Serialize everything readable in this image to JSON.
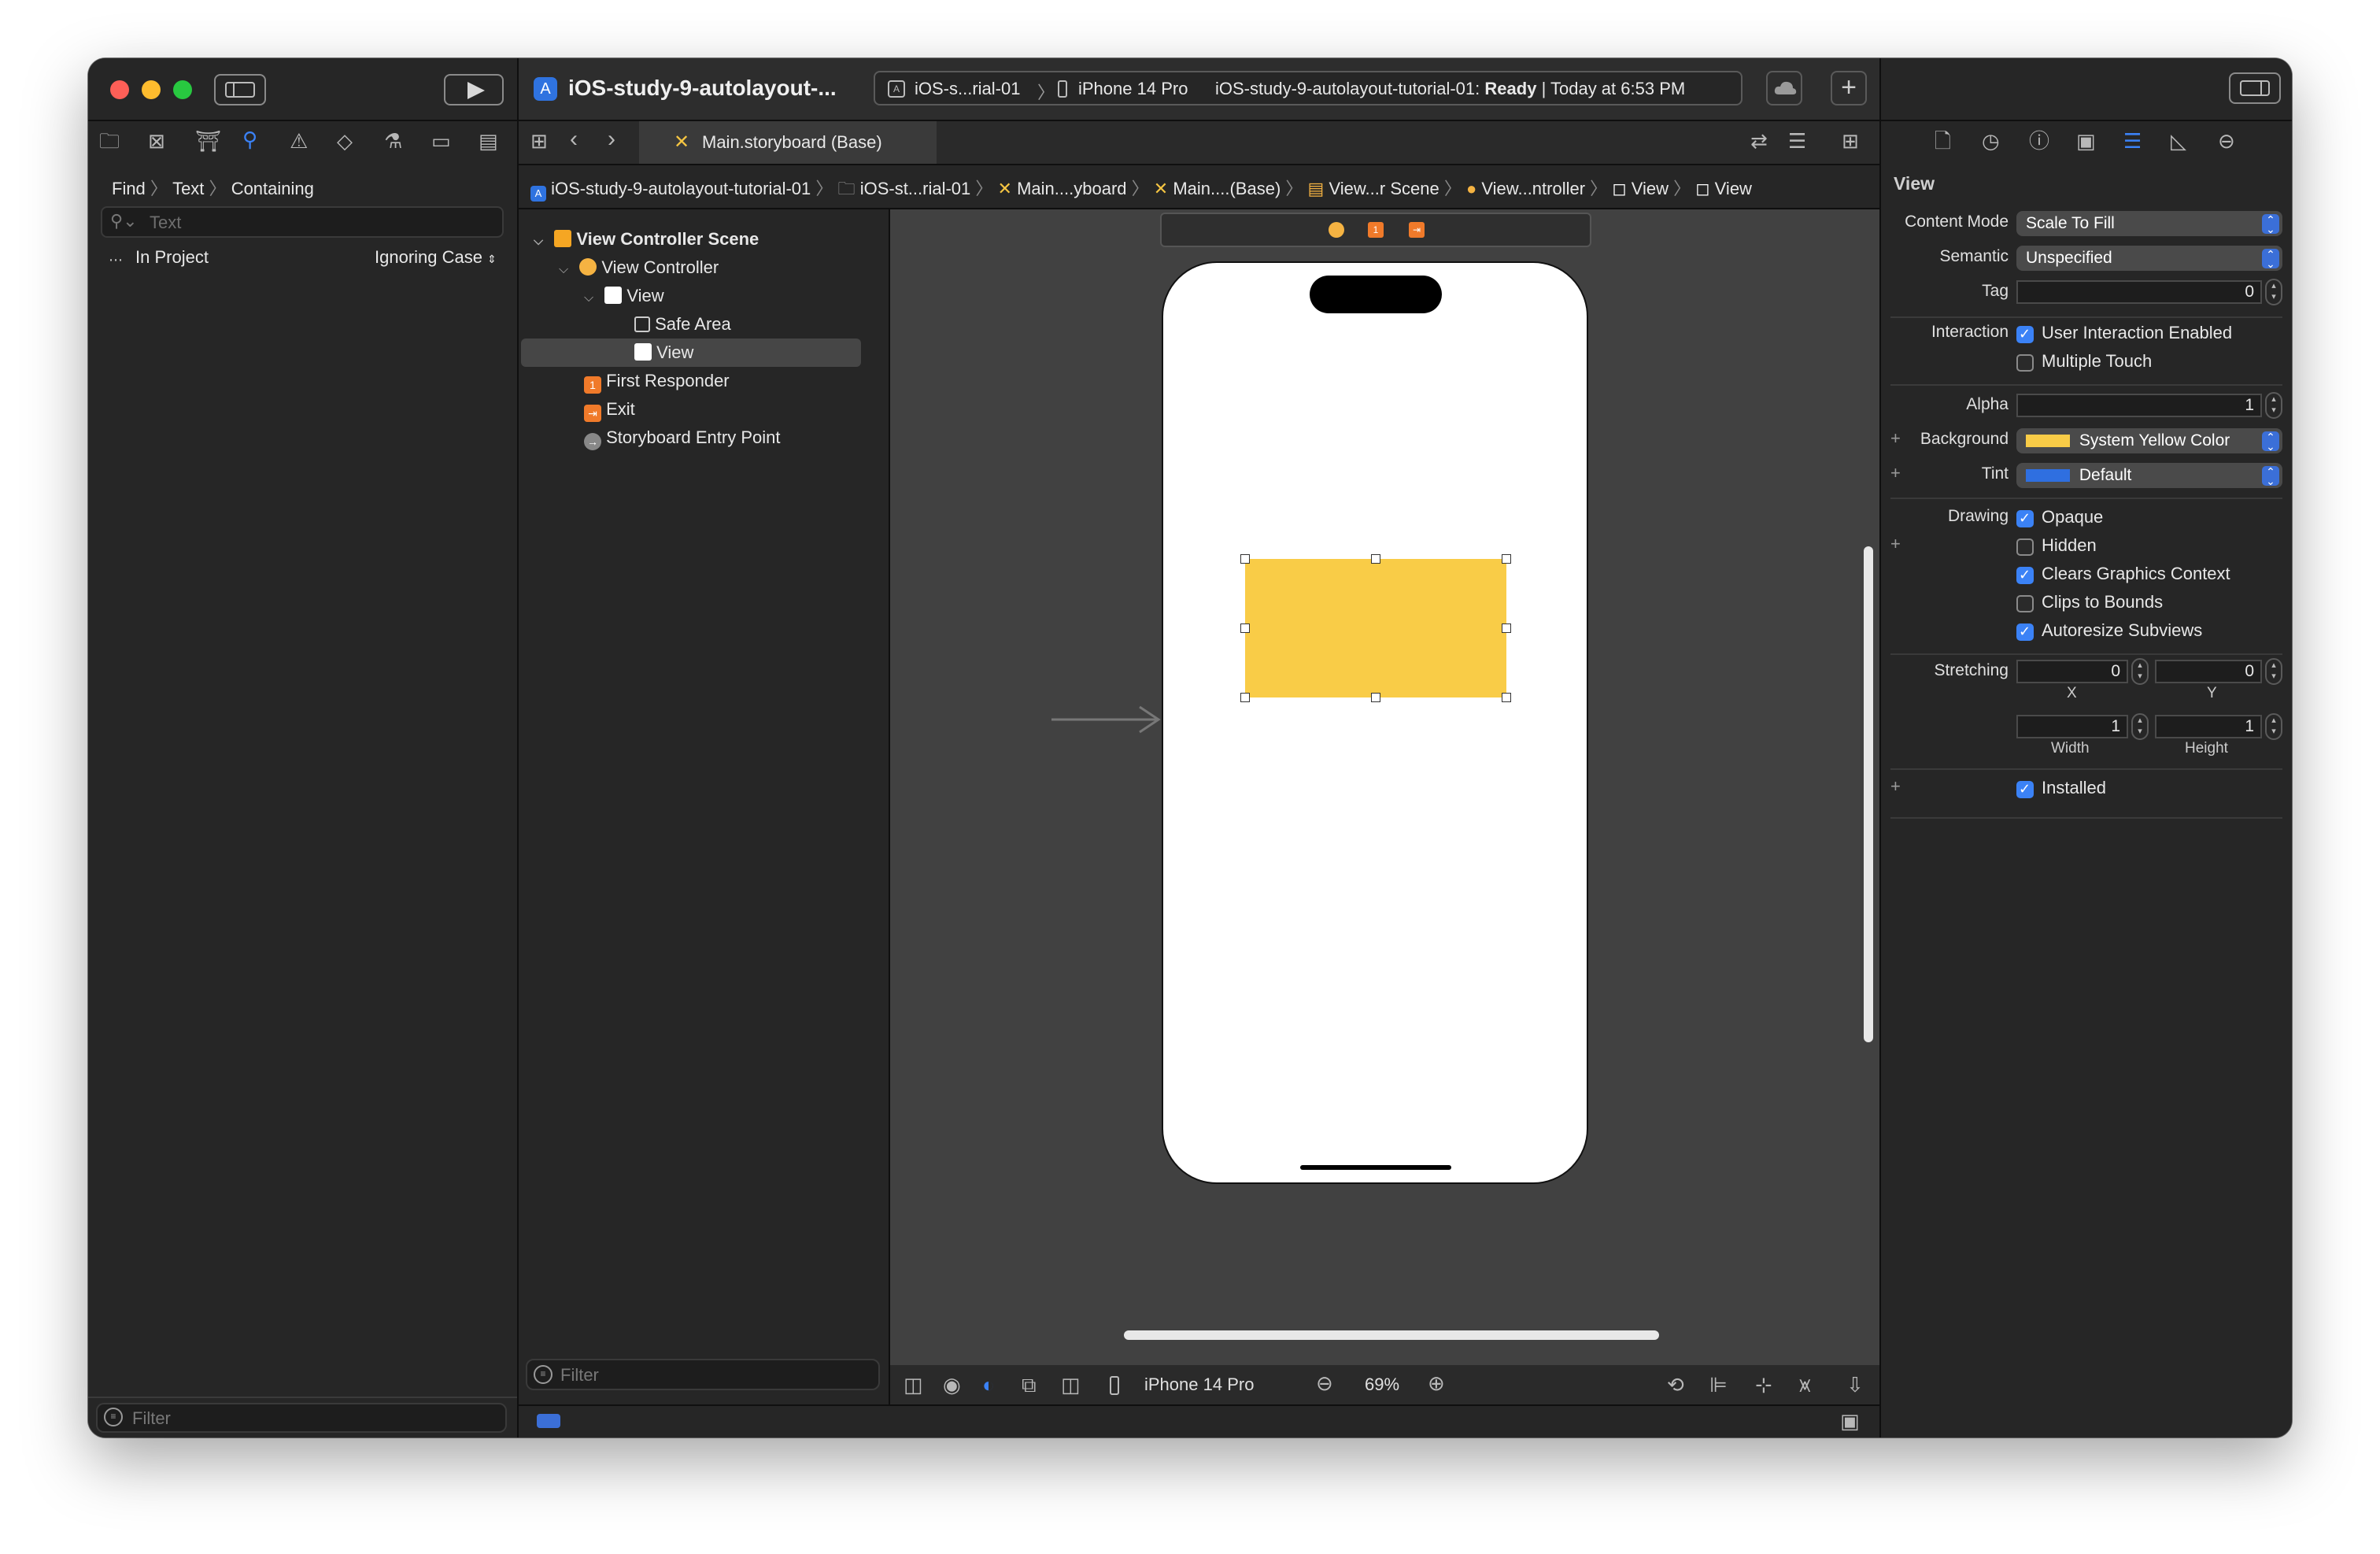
{
  "toolbar": {
    "project_title": "iOS-study-9-autolayout-...",
    "scheme_short": "iOS-s...rial-01",
    "device": "iPhone 14 Pro",
    "status_project": "iOS-study-9-autolayout-tutorial-01:",
    "status_state": "Ready",
    "status_time": "| Today at 6:53 PM"
  },
  "find_nav": {
    "crumb_find": "Find",
    "crumb_text": "Text",
    "crumb_containing": "Containing",
    "search_placeholder": "Text",
    "scope": "In Project",
    "case_mode": "Ignoring Case",
    "filter_placeholder": "Filter"
  },
  "editor": {
    "tab_label": "Main.storyboard (Base)",
    "breadcrumbs": [
      "iOS-study-9-autolayout-tutorial-01",
      "iOS-st...rial-01",
      "Main....yboard",
      "Main....(Base)",
      "View...r Scene",
      "View...ntroller",
      "View",
      "View"
    ]
  },
  "outline": {
    "items": [
      {
        "label": "View Controller Scene"
      },
      {
        "label": "View Controller"
      },
      {
        "label": "View"
      },
      {
        "label": "Safe Area"
      },
      {
        "label": "View"
      },
      {
        "label": "First Responder"
      },
      {
        "label": "Exit"
      },
      {
        "label": "Storyboard Entry Point"
      }
    ],
    "filter_placeholder": "Filter"
  },
  "canvas_bar": {
    "device": "iPhone 14 Pro",
    "zoom": "69%"
  },
  "inspector": {
    "section_title": "View",
    "content_mode_label": "Content Mode",
    "content_mode_value": "Scale To Fill",
    "semantic_label": "Semantic",
    "semantic_value": "Unspecified",
    "tag_label": "Tag",
    "tag_value": "0",
    "interaction_label": "Interaction",
    "user_interaction": "User Interaction Enabled",
    "multiple_touch": "Multiple Touch",
    "alpha_label": "Alpha",
    "alpha_value": "1",
    "background_label": "Background",
    "background_value": "System Yellow Color",
    "tint_label": "Tint",
    "tint_value": "Default",
    "drawing_label": "Drawing",
    "opaque": "Opaque",
    "hidden": "Hidden",
    "clears_context": "Clears Graphics Context",
    "clips_bounds": "Clips to Bounds",
    "autoresize": "Autoresize Subviews",
    "stretching_label": "Stretching",
    "stretch_x": "0",
    "stretch_y": "0",
    "x_label": "X",
    "y_label": "Y",
    "stretch_w": "1",
    "stretch_h": "1",
    "width_label": "Width",
    "height_label": "Height",
    "installed": "Installed"
  },
  "colors": {
    "accent": "#3b82f6",
    "system_yellow": "#f9cc47",
    "tint_default": "#2f6fe0"
  }
}
